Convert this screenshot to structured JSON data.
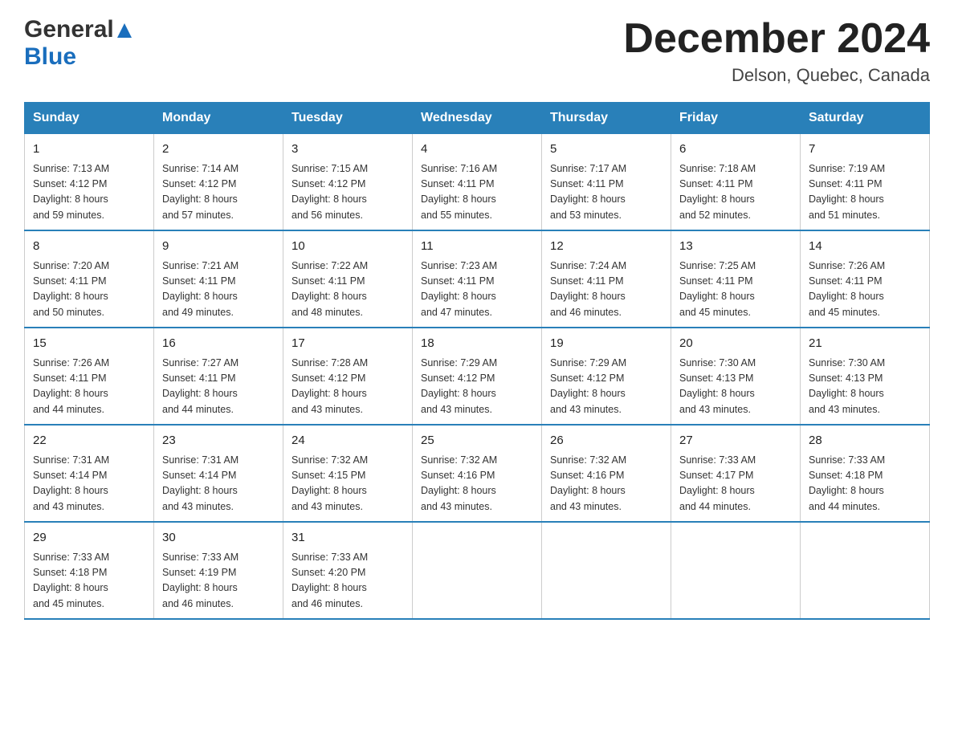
{
  "header": {
    "logo_general": "General",
    "logo_blue": "Blue",
    "month_title": "December 2024",
    "location": "Delson, Quebec, Canada"
  },
  "days_of_week": [
    "Sunday",
    "Monday",
    "Tuesday",
    "Wednesday",
    "Thursday",
    "Friday",
    "Saturday"
  ],
  "weeks": [
    [
      {
        "day": "1",
        "sunrise": "7:13 AM",
        "sunset": "4:12 PM",
        "daylight": "8 hours and 59 minutes."
      },
      {
        "day": "2",
        "sunrise": "7:14 AM",
        "sunset": "4:12 PM",
        "daylight": "8 hours and 57 minutes."
      },
      {
        "day": "3",
        "sunrise": "7:15 AM",
        "sunset": "4:12 PM",
        "daylight": "8 hours and 56 minutes."
      },
      {
        "day": "4",
        "sunrise": "7:16 AM",
        "sunset": "4:11 PM",
        "daylight": "8 hours and 55 minutes."
      },
      {
        "day": "5",
        "sunrise": "7:17 AM",
        "sunset": "4:11 PM",
        "daylight": "8 hours and 53 minutes."
      },
      {
        "day": "6",
        "sunrise": "7:18 AM",
        "sunset": "4:11 PM",
        "daylight": "8 hours and 52 minutes."
      },
      {
        "day": "7",
        "sunrise": "7:19 AM",
        "sunset": "4:11 PM",
        "daylight": "8 hours and 51 minutes."
      }
    ],
    [
      {
        "day": "8",
        "sunrise": "7:20 AM",
        "sunset": "4:11 PM",
        "daylight": "8 hours and 50 minutes."
      },
      {
        "day": "9",
        "sunrise": "7:21 AM",
        "sunset": "4:11 PM",
        "daylight": "8 hours and 49 minutes."
      },
      {
        "day": "10",
        "sunrise": "7:22 AM",
        "sunset": "4:11 PM",
        "daylight": "8 hours and 48 minutes."
      },
      {
        "day": "11",
        "sunrise": "7:23 AM",
        "sunset": "4:11 PM",
        "daylight": "8 hours and 47 minutes."
      },
      {
        "day": "12",
        "sunrise": "7:24 AM",
        "sunset": "4:11 PM",
        "daylight": "8 hours and 46 minutes."
      },
      {
        "day": "13",
        "sunrise": "7:25 AM",
        "sunset": "4:11 PM",
        "daylight": "8 hours and 45 minutes."
      },
      {
        "day": "14",
        "sunrise": "7:26 AM",
        "sunset": "4:11 PM",
        "daylight": "8 hours and 45 minutes."
      }
    ],
    [
      {
        "day": "15",
        "sunrise": "7:26 AM",
        "sunset": "4:11 PM",
        "daylight": "8 hours and 44 minutes."
      },
      {
        "day": "16",
        "sunrise": "7:27 AM",
        "sunset": "4:11 PM",
        "daylight": "8 hours and 44 minutes."
      },
      {
        "day": "17",
        "sunrise": "7:28 AM",
        "sunset": "4:12 PM",
        "daylight": "8 hours and 43 minutes."
      },
      {
        "day": "18",
        "sunrise": "7:29 AM",
        "sunset": "4:12 PM",
        "daylight": "8 hours and 43 minutes."
      },
      {
        "day": "19",
        "sunrise": "7:29 AM",
        "sunset": "4:12 PM",
        "daylight": "8 hours and 43 minutes."
      },
      {
        "day": "20",
        "sunrise": "7:30 AM",
        "sunset": "4:13 PM",
        "daylight": "8 hours and 43 minutes."
      },
      {
        "day": "21",
        "sunrise": "7:30 AM",
        "sunset": "4:13 PM",
        "daylight": "8 hours and 43 minutes."
      }
    ],
    [
      {
        "day": "22",
        "sunrise": "7:31 AM",
        "sunset": "4:14 PM",
        "daylight": "8 hours and 43 minutes."
      },
      {
        "day": "23",
        "sunrise": "7:31 AM",
        "sunset": "4:14 PM",
        "daylight": "8 hours and 43 minutes."
      },
      {
        "day": "24",
        "sunrise": "7:32 AM",
        "sunset": "4:15 PM",
        "daylight": "8 hours and 43 minutes."
      },
      {
        "day": "25",
        "sunrise": "7:32 AM",
        "sunset": "4:16 PM",
        "daylight": "8 hours and 43 minutes."
      },
      {
        "day": "26",
        "sunrise": "7:32 AM",
        "sunset": "4:16 PM",
        "daylight": "8 hours and 43 minutes."
      },
      {
        "day": "27",
        "sunrise": "7:33 AM",
        "sunset": "4:17 PM",
        "daylight": "8 hours and 44 minutes."
      },
      {
        "day": "28",
        "sunrise": "7:33 AM",
        "sunset": "4:18 PM",
        "daylight": "8 hours and 44 minutes."
      }
    ],
    [
      {
        "day": "29",
        "sunrise": "7:33 AM",
        "sunset": "4:18 PM",
        "daylight": "8 hours and 45 minutes."
      },
      {
        "day": "30",
        "sunrise": "7:33 AM",
        "sunset": "4:19 PM",
        "daylight": "8 hours and 46 minutes."
      },
      {
        "day": "31",
        "sunrise": "7:33 AM",
        "sunset": "4:20 PM",
        "daylight": "8 hours and 46 minutes."
      },
      null,
      null,
      null,
      null
    ]
  ],
  "labels": {
    "sunrise": "Sunrise:",
    "sunset": "Sunset:",
    "daylight": "Daylight:"
  }
}
